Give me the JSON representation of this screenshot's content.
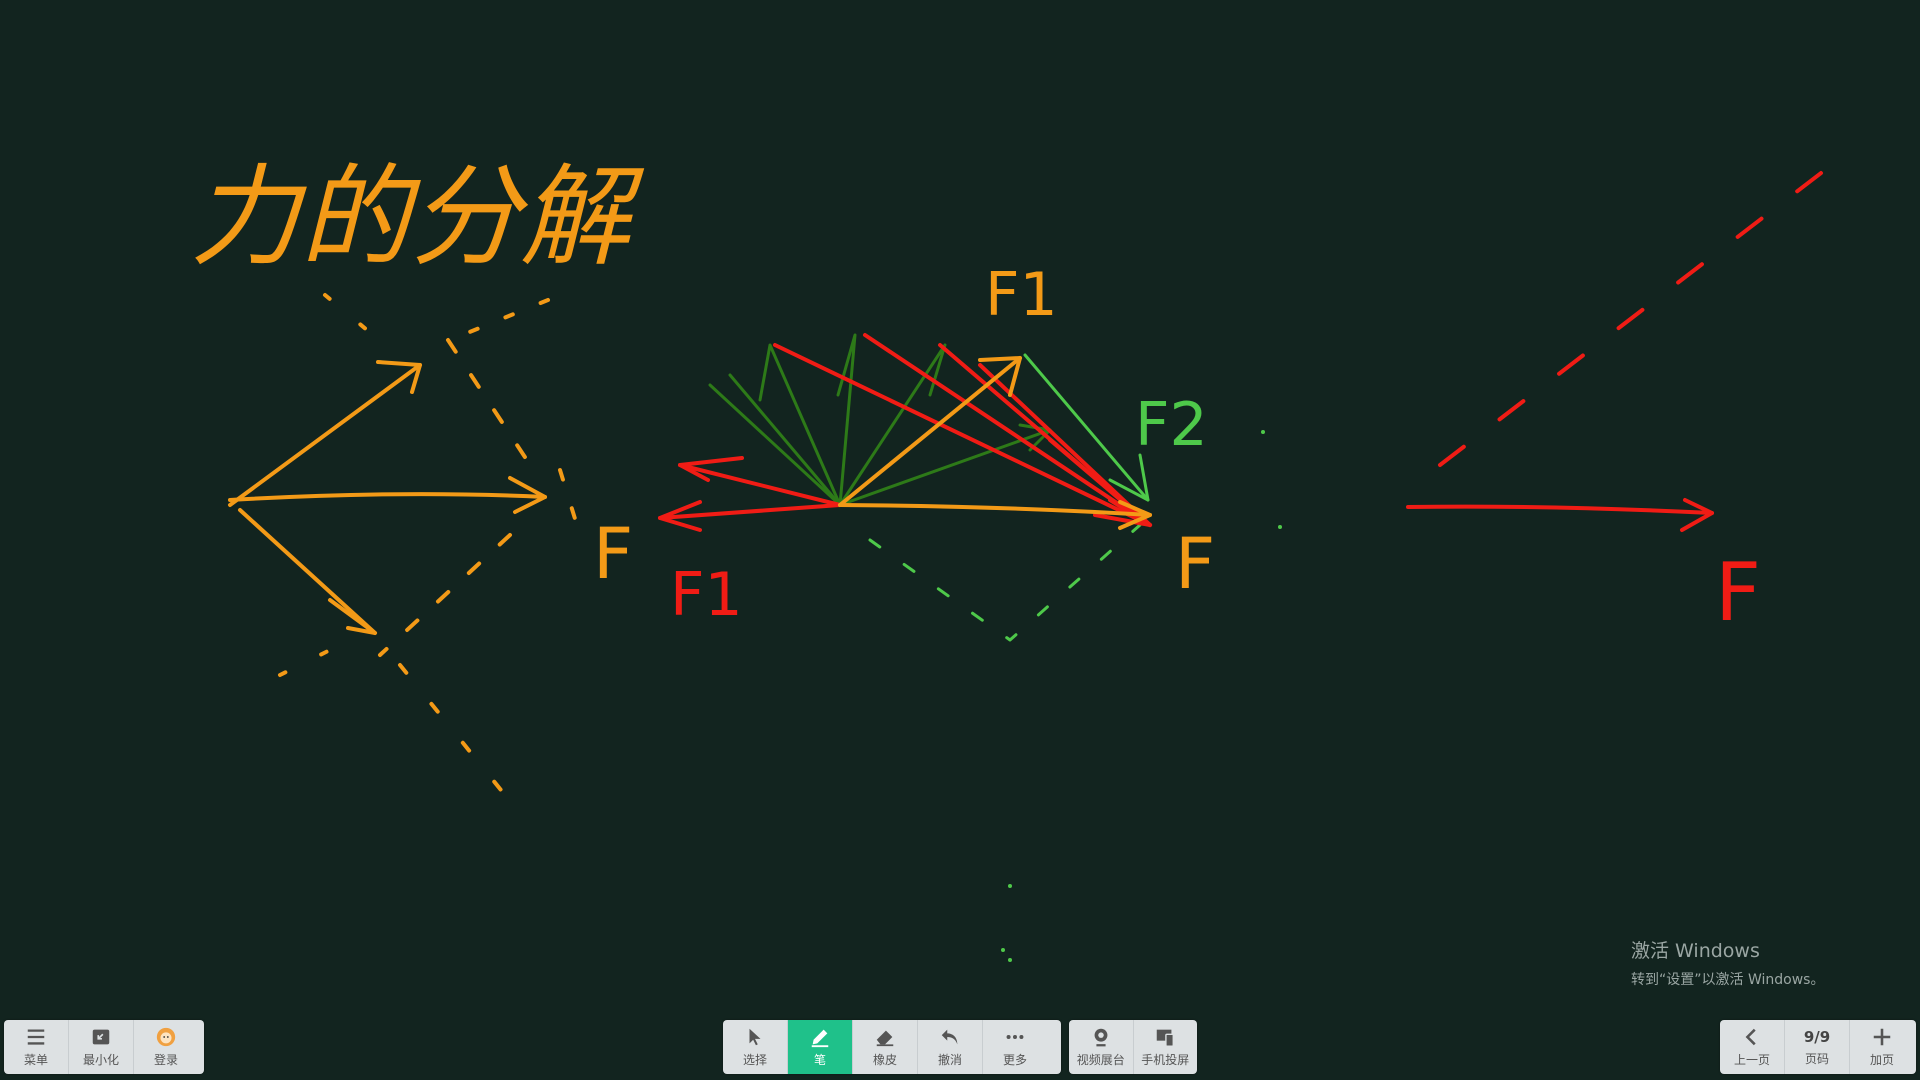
{
  "canvas": {
    "title_text": "力的分解",
    "labels": {
      "f_left": "F",
      "f1_red": "F1",
      "f1_top": "F1",
      "f2_green": "F2",
      "f_middle": "F",
      "f_right": "F"
    },
    "colors": {
      "background": "#12241f",
      "orange": "#f39a17",
      "red": "#f01c15",
      "green": "#4ec94a",
      "dark_green": "#2d7a18"
    }
  },
  "toolbar_left": {
    "menu_label": "菜单",
    "minimize_label": "最小化",
    "login_label": "登录"
  },
  "toolbar_center": {
    "select_label": "选择",
    "pen_label": "笔",
    "eraser_label": "橡皮",
    "undo_label": "撤消",
    "more_label": "更多",
    "video_label": "视频展台",
    "phone_label": "手机投屏"
  },
  "toolbar_right": {
    "prev_label": "上一页",
    "page_value": "9/9",
    "page_label": "页码",
    "add_label": "加页"
  },
  "watermark": {
    "title": "激活 Windows",
    "subtitle": "转到“设置”以激活 Windows。"
  }
}
